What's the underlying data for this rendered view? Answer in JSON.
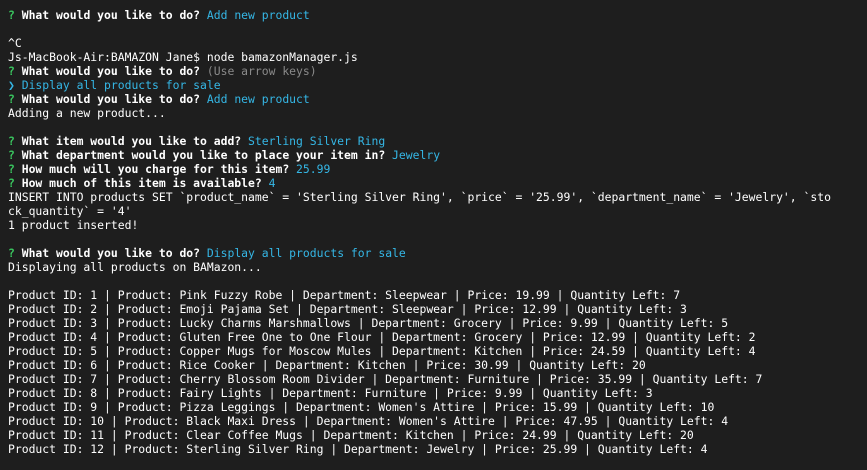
{
  "colors": {
    "background": "#1e1e1e",
    "text": "#ffffff",
    "prompt_mark": "#3ac55f",
    "answer": "#35b7e6",
    "hint": "#8a8a8a"
  },
  "lines": [
    {
      "parts": [
        {
          "c": "q",
          "t": "? "
        },
        {
          "c": "b",
          "t": "What would you like to do? "
        },
        {
          "c": "ans",
          "t": "Add new product"
        }
      ]
    },
    {
      "parts": []
    },
    {
      "parts": [
        {
          "c": "plain",
          "t": "^C"
        }
      ]
    },
    {
      "parts": [
        {
          "c": "plain",
          "t": "Js-MacBook-Air:BAMAZON Jane$ node bamazonManager.js"
        }
      ]
    },
    {
      "parts": [
        {
          "c": "q",
          "t": "? "
        },
        {
          "c": "b",
          "t": "What would you like to do? "
        },
        {
          "c": "dim",
          "t": "(Use arrow keys)"
        }
      ]
    },
    {
      "parts": [
        {
          "c": "sel",
          "t": "❯ Display all products for sale"
        }
      ]
    },
    {
      "parts": [
        {
          "c": "q",
          "t": "? "
        },
        {
          "c": "b",
          "t": "What would you like to do? "
        },
        {
          "c": "ans",
          "t": "Add new product"
        }
      ]
    },
    {
      "parts": [
        {
          "c": "plain",
          "t": "Adding a new product..."
        }
      ]
    },
    {
      "parts": []
    },
    {
      "parts": [
        {
          "c": "q",
          "t": "? "
        },
        {
          "c": "b",
          "t": "What item would you like to add? "
        },
        {
          "c": "ans",
          "t": "Sterling Silver Ring"
        }
      ]
    },
    {
      "parts": [
        {
          "c": "q",
          "t": "? "
        },
        {
          "c": "b",
          "t": "What department would you like to place your item in? "
        },
        {
          "c": "ans",
          "t": "Jewelry"
        }
      ]
    },
    {
      "parts": [
        {
          "c": "q",
          "t": "? "
        },
        {
          "c": "b",
          "t": "How much will you charge for this item? "
        },
        {
          "c": "ans",
          "t": "25.99"
        }
      ]
    },
    {
      "parts": [
        {
          "c": "q",
          "t": "? "
        },
        {
          "c": "b",
          "t": "How much of this item is available? "
        },
        {
          "c": "ans",
          "t": "4"
        }
      ]
    },
    {
      "parts": [
        {
          "c": "plain",
          "t": "INSERT INTO products SET `product_name` = 'Sterling Silver Ring', `price` = '25.99', `department_name` = 'Jewelry', `sto"
        }
      ]
    },
    {
      "parts": [
        {
          "c": "plain",
          "t": "ck_quantity` = '4'"
        }
      ]
    },
    {
      "parts": [
        {
          "c": "plain",
          "t": "1 product inserted!"
        }
      ]
    },
    {
      "parts": []
    },
    {
      "parts": [
        {
          "c": "q",
          "t": "? "
        },
        {
          "c": "b",
          "t": "What would you like to do? "
        },
        {
          "c": "ans",
          "t": "Display all products for sale"
        }
      ]
    },
    {
      "parts": [
        {
          "c": "plain",
          "t": "Displaying all products on BAMazon..."
        }
      ]
    },
    {
      "parts": []
    },
    {
      "parts": [
        {
          "c": "plain",
          "t": "Product ID: 1 | Product: Pink Fuzzy Robe | Department: Sleepwear | Price: 19.99 | Quantity Left: 7"
        }
      ]
    },
    {
      "parts": [
        {
          "c": "plain",
          "t": "Product ID: 2 | Product: Emoji Pajama Set | Department: Sleepwear | Price: 12.99 | Quantity Left: 3"
        }
      ]
    },
    {
      "parts": [
        {
          "c": "plain",
          "t": "Product ID: 3 | Product: Lucky Charms Marshmallows | Department: Grocery | Price: 9.99 | Quantity Left: 5"
        }
      ]
    },
    {
      "parts": [
        {
          "c": "plain",
          "t": "Product ID: 4 | Product: Gluten Free One to One Flour | Department: Grocery | Price: 12.99 | Quantity Left: 2"
        }
      ]
    },
    {
      "parts": [
        {
          "c": "plain",
          "t": "Product ID: 5 | Product: Copper Mugs for Moscow Mules | Department: Kitchen | Price: 24.59 | Quantity Left: 4"
        }
      ]
    },
    {
      "parts": [
        {
          "c": "plain",
          "t": "Product ID: 6 | Product: Rice Cooker | Department: Kitchen | Price: 30.99 | Quantity Left: 20"
        }
      ]
    },
    {
      "parts": [
        {
          "c": "plain",
          "t": "Product ID: 7 | Product: Cherry Blossom Room Divider | Department: Furniture | Price: 35.99 | Quantity Left: 7"
        }
      ]
    },
    {
      "parts": [
        {
          "c": "plain",
          "t": "Product ID: 8 | Product: Fairy Lights | Department: Furniture | Price: 9.99 | Quantity Left: 3"
        }
      ]
    },
    {
      "parts": [
        {
          "c": "plain",
          "t": "Product ID: 9 | Product: Pizza Leggings | Department: Women's Attire | Price: 15.99 | Quantity Left: 10"
        }
      ]
    },
    {
      "parts": [
        {
          "c": "plain",
          "t": "Product ID: 10 | Product: Black Maxi Dress | Department: Women's Attire | Price: 47.95 | Quantity Left: 4"
        }
      ]
    },
    {
      "parts": [
        {
          "c": "plain",
          "t": "Product ID: 11 | Product: Clear Coffee Mugs | Department: Kitchen | Price: 24.99 | Quantity Left: 20"
        }
      ]
    },
    {
      "parts": [
        {
          "c": "plain",
          "t": "Product ID: 12 | Product: Sterling Silver Ring | Department: Jewelry | Price: 25.99 | Quantity Left: 4"
        }
      ]
    }
  ]
}
